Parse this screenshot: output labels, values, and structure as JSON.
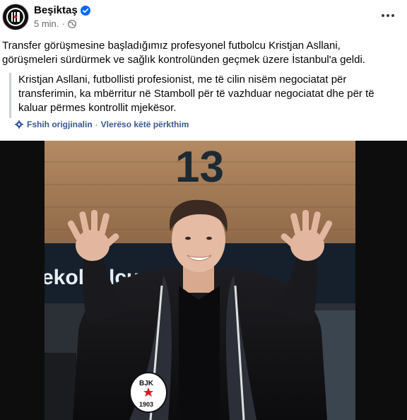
{
  "post": {
    "author": "Beşiktaş",
    "time": "5 min.",
    "text": "Transfer görüşmesine başladığımız profesyonel futbolcu Kristjan Asllani, görüşmeleri sürdürmek ve sağlık kontrolünden geçmek üzere İstanbul'a geldi.",
    "translation": "Kristjan Asllani, futbollisti profesionist, me të cilin nisëm negociatat për transferimin, ka mbërritur në Stamboll për të vazhduar negociatat dhe për të kaluar përmes kontrollit mjekësor.",
    "show_original_label": "Fshih origjinalin",
    "rate_translation_label": "Vlerëso këtë përkthim",
    "separator": "·"
  },
  "photo": {
    "sign_number": "13",
    "sign_text": "ekolyolcu",
    "crest_letters": "BJK",
    "crest_year": "1903"
  },
  "colors": {
    "link": "#385898",
    "meta": "#65676b",
    "verified": "#0866ff",
    "photo_frame": "#0d0d0d"
  },
  "icons": {
    "verified": "verified-badge-icon",
    "audience": "globe-icon",
    "more": "more-options-icon",
    "translation": "gear-icon"
  }
}
